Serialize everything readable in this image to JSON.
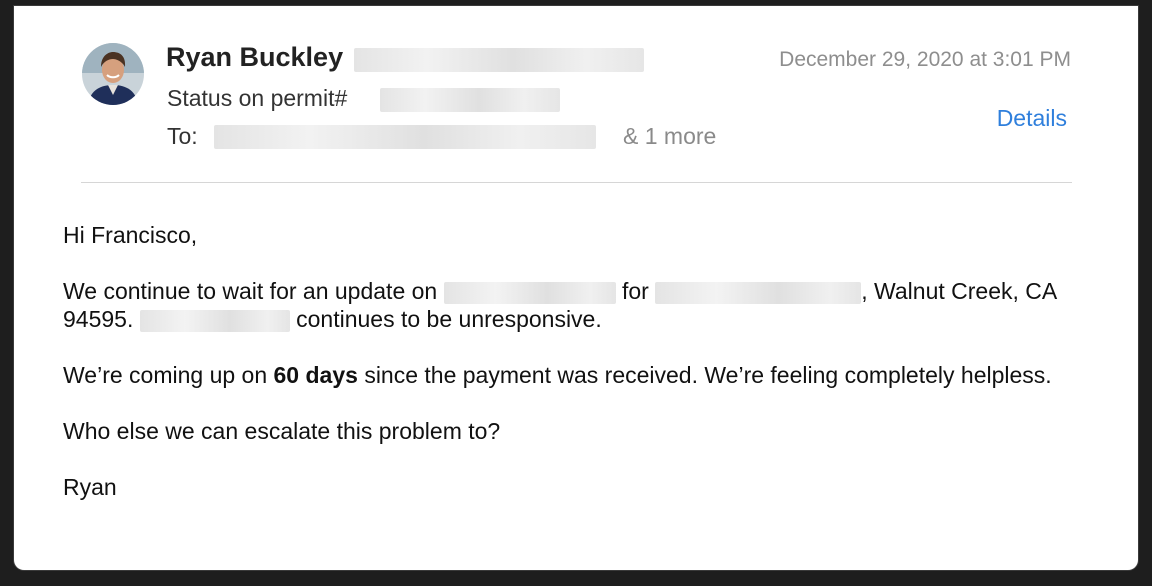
{
  "sender": {
    "name": "Ryan Buckley"
  },
  "subject": {
    "label": "Status on permit#"
  },
  "to": {
    "label": "To:",
    "more": "& 1 more"
  },
  "date": "December 29, 2020 at 3:01 PM",
  "details_link": "Details",
  "body": {
    "greeting": "Hi Francisco,",
    "p1_a": "We continue to wait for an update on",
    "p1_b": "for",
    "p1_c": ", Walnut Creek, CA 94595.",
    "p1_d": "continues to be unresponsive.",
    "p2_a": "We’re coming up on",
    "p2_bold": "60 days",
    "p2_b": "since the payment was received. We’re feeling completely helpless.",
    "p3": "Who else we can escalate this problem to?",
    "signature": "Ryan"
  },
  "colors": {
    "link": "#2f7fdc",
    "meta_gray": "#8e8e8e"
  }
}
